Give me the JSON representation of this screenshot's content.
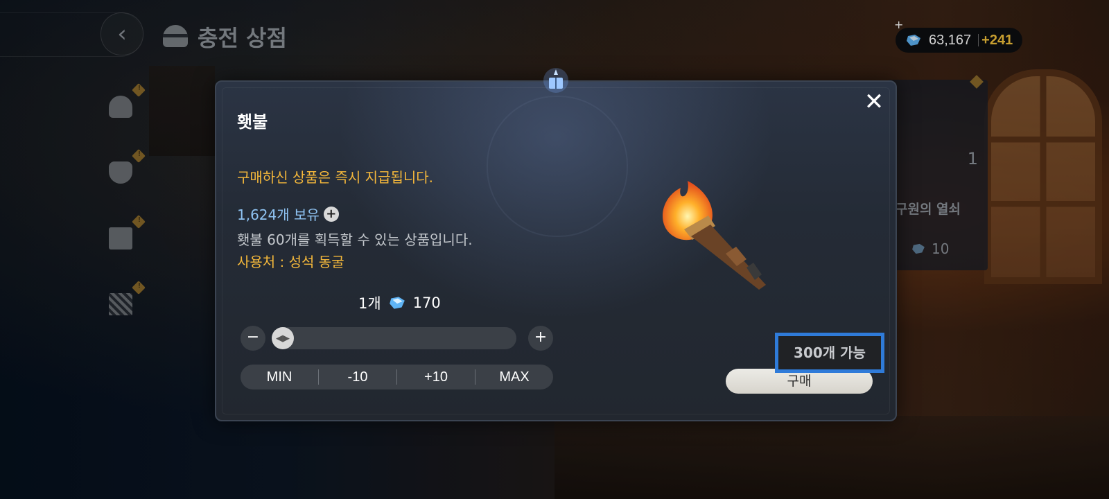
{
  "header": {
    "back_icon": "chevron-left-icon",
    "shop_icon": "rice-bowl-icon",
    "title": "충전 상점"
  },
  "currency": {
    "icon": "blue-gem-icon",
    "amount": "63,167",
    "bonus": "+241",
    "plus_mark": "+"
  },
  "sidebar": {
    "items": [
      {
        "icon": "rice-bowl-icon",
        "badge": "!"
      },
      {
        "icon": "money-bag-icon",
        "badge": "!"
      },
      {
        "icon": "shop-stall-icon",
        "badge": "!"
      },
      {
        "icon": "crate-icon",
        "badge": "!"
      }
    ]
  },
  "background_card": {
    "count": "1",
    "name": "구원의 열쇠",
    "price": "10"
  },
  "modal": {
    "title": "횃불",
    "close_icon": "close-icon",
    "notice": "구매하신 상품은 즉시 지급됩니다.",
    "owned": "1,624개 보유",
    "owned_plus": "+",
    "description": "횃불 60개를 획득할 수 있는 상품입니다.",
    "usage": "사용처 : 성석 동굴",
    "quantity_label": "1개",
    "unit_price": "170",
    "minus_label": "−",
    "plus_label": "+",
    "slider_value_fraction": 0,
    "steps": [
      "MIN",
      "-10",
      "+10",
      "MAX"
    ],
    "buy_label": "구매",
    "available_label": "300개 가능",
    "item_icon": "torch-icon",
    "colors": {
      "notice": "#f5b83b",
      "owned": "#8fc3f2",
      "highlight": "#2f7bd9"
    }
  }
}
